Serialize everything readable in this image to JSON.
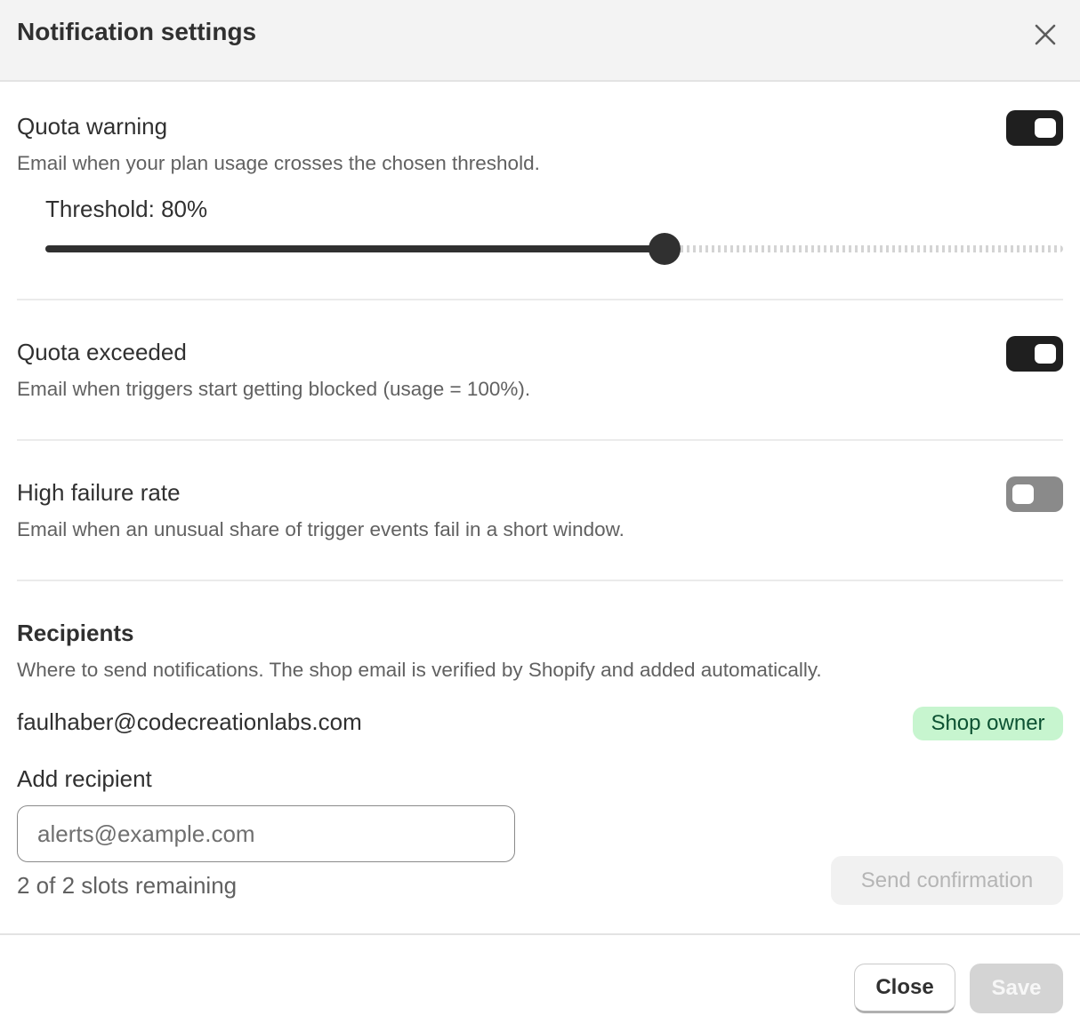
{
  "dialog": {
    "title": "Notification settings"
  },
  "quota_warning": {
    "title": "Quota warning",
    "description": "Email when your plan usage crosses the chosen threshold.",
    "enabled": true,
    "threshold_label": "Threshold: 80%",
    "threshold_percent": 80
  },
  "quota_exceeded": {
    "title": "Quota exceeded",
    "description": "Email when triggers start getting blocked (usage = 100%).",
    "enabled": true
  },
  "high_failure_rate": {
    "title": "High failure rate",
    "description": "Email when an unusual share of trigger events fail in a short window.",
    "enabled": false
  },
  "recipients": {
    "title": "Recipients",
    "description": "Where to send notifications. The shop email is verified by Shopify and added automatically.",
    "items": [
      {
        "email": "faulhaber@codecreationlabs.com",
        "badge": "Shop owner"
      }
    ],
    "add_label": "Add recipient",
    "input_placeholder": "alerts@example.com",
    "input_value": "",
    "slots_text": "2 of 2 slots remaining",
    "send_label": "Send confirmation"
  },
  "footer": {
    "close_label": "Close",
    "save_label": "Save"
  },
  "colors": {
    "toggle_on": "#1f1f1f",
    "toggle_off": "#8a8a8a",
    "badge_bg": "#c7f5cf",
    "badge_text": "#0c5132"
  },
  "icons": {
    "close": "close-icon"
  }
}
